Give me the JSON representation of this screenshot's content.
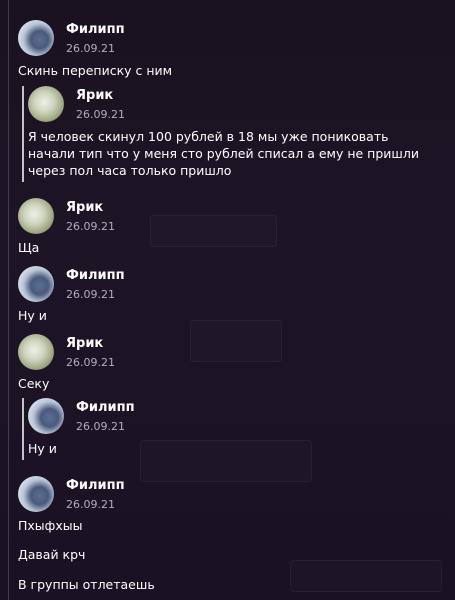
{
  "messages": [
    {
      "sender": "Филипп",
      "date": "26.09.21",
      "avatar": "filipp-avatar",
      "text": "Скинь переписку с ним"
    },
    {
      "sender": "Ярик",
      "date": "26.09.21",
      "avatar": "yarik-avatar",
      "text": "Я человек скинул 100 рублей в 18 мы уже пониковать начали тип что у меня сто рублей списал а ему не пришли через пол часа только пришло",
      "quoted": true
    },
    {
      "sender": "Ярик",
      "date": "26.09.21",
      "avatar": "yarik-avatar",
      "text": "Ща"
    },
    {
      "sender": "Филипп",
      "date": "26.09.21",
      "avatar": "filipp-avatar",
      "text": "Ну и"
    },
    {
      "sender": "Ярик",
      "date": "26.09.21",
      "avatar": "yarik-avatar",
      "text": "Секу"
    },
    {
      "sender": "Филипп",
      "date": "26.09.21",
      "avatar": "filipp-avatar",
      "text": "Ну и",
      "quoted": true
    },
    {
      "sender": "Филипп",
      "date": "26.09.21",
      "avatar": "filipp-avatar",
      "lines": [
        "Пхыфхыы",
        "Давай крч",
        "В группы отлетаешь"
      ]
    }
  ],
  "colors": {
    "background": "#1c1424",
    "text": "#ffffff",
    "date": "#b3aebb"
  }
}
